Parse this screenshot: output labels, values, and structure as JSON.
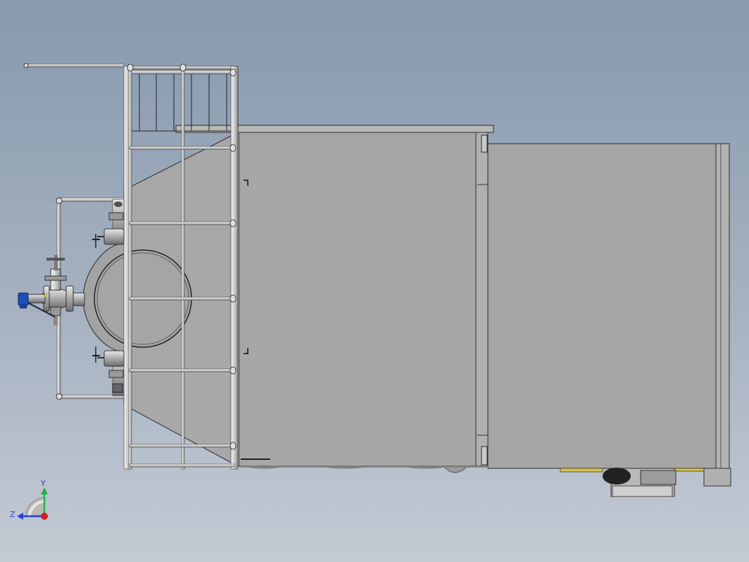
{
  "viewport": {
    "background_top": "#8799ad",
    "background_bottom": "#c3cad4"
  },
  "model": {
    "body_color": "#a7a7a7",
    "panel_color": "#a3a3a3",
    "frame_color": "#bdbdbd",
    "edge_color": "#2b2b2b",
    "valve_accent_color": "#1d4fb8",
    "detail_yellow": "#d7c24a"
  },
  "triad": {
    "y_label": "Y",
    "z_label": "Z",
    "y_color": "#22b14c",
    "z_color": "#2a3fd6",
    "x_color": "#d42020"
  }
}
